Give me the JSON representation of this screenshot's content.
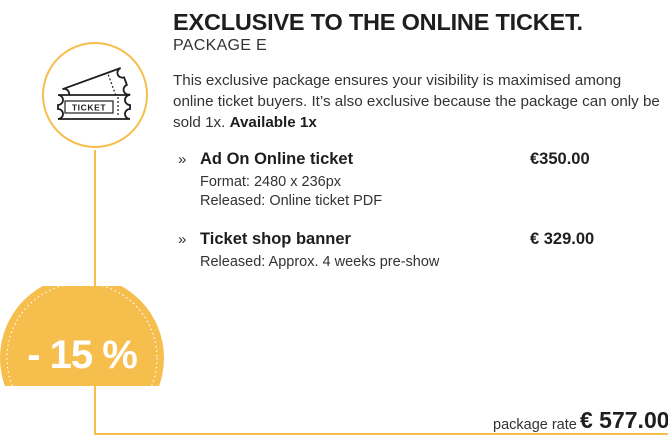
{
  "package": {
    "title": "EXCLUSIVE TO THE ONLINE TICKET.",
    "subtitle": "PACKAGE E",
    "description": "This exclusive package ensures your visibility is maximised among online ticket buyers. It’s also exclusive because the package can only be sold 1x.",
    "availability": "Available 1x"
  },
  "items": [
    {
      "bullet": "»",
      "name": "Ad On Online ticket",
      "price": "€350.00",
      "details": [
        "Format: 2480 x 236px",
        "Released: Online ticket PDF"
      ]
    },
    {
      "bullet": "»",
      "name": "Ticket shop banner",
      "price": "€ 329.00",
      "details": [
        "Released: Approx. 4 weeks pre-show"
      ]
    }
  ],
  "ticket_icon": {
    "name": "ticket-icon",
    "label": "TICKET"
  },
  "discount_badge": "- 15 %",
  "rate": {
    "label": "package rate",
    "value": "€ 577.00"
  },
  "colors": {
    "accent": "#F6BE4C",
    "text": "#1E1E1E"
  }
}
